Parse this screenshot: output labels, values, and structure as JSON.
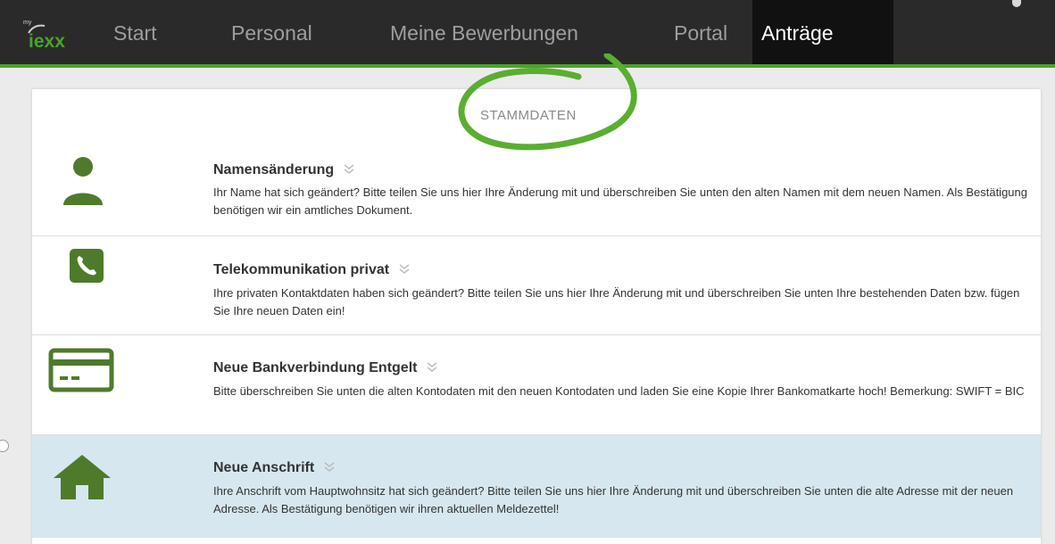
{
  "header": {
    "logo_tag": "my",
    "logo_brand": "iexx",
    "nav": [
      "Start",
      "Personal",
      "Meine Bewerbungen",
      "Portal"
    ],
    "nav_active": "Anträge"
  },
  "section_title": "STAMMDATEN",
  "items": [
    {
      "title": "Namensänderung",
      "description": "Ihr Name hat sich geändert? Bitte teilen Sie uns hier Ihre Änderung mit und überschreiben Sie unten den alten Namen mit dem neuen Namen. Als Bestätigung benötigen wir ein amtliches Dokument.",
      "icon": "person-icon"
    },
    {
      "title": "Telekommunikation privat",
      "description": "Ihre privaten Kontaktdaten haben sich geändert? Bitte teilen Sie uns hier Ihre Änderung mit und überschreiben Sie unten Ihre bestehenden Daten bzw. fügen Sie Ihre neuen Daten ein!",
      "icon": "phone-icon"
    },
    {
      "title": "Neue Bankverbindung Entgelt",
      "description": "Bitte überschreiben Sie unten die alten Kontodaten mit den neuen Kontodaten und laden Sie eine Kopie Ihrer Bankomatkarte hoch! Bemerkung: SWIFT = BIC",
      "icon": "bank-card-icon"
    },
    {
      "title": "Neue Anschrift",
      "description": "Ihre Anschrift vom Hauptwohnsitz hat sich geändert? Bitte teilen Sie uns hier Ihre Änderung mit und überschreiben Sie unten die alte Adresse mit der neuen Adresse. Als Bestätigung benötigen wir ihren aktuellen Meldezettel!",
      "icon": "house-icon"
    }
  ],
  "colors": {
    "accent_green": "#4aa32a",
    "icon_green": "#4f7a2c",
    "nav_bg": "#2a2a2a",
    "active_row_bg": "#d6e7ef"
  }
}
